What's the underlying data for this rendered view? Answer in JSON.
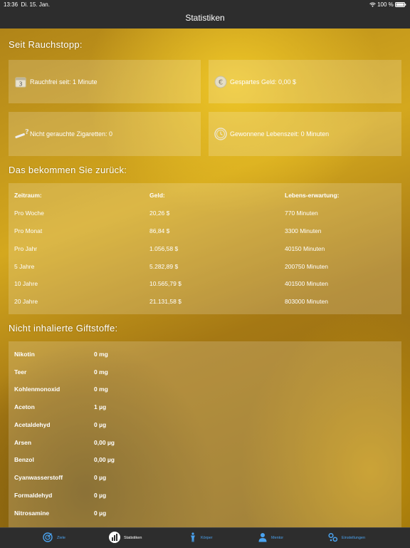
{
  "status_bar": {
    "time": "13:36",
    "date": "Di. 15. Jan.",
    "battery": "100 %"
  },
  "nav": {
    "title": "Statistiken"
  },
  "since_quit": {
    "title": "Seit Rauchstopp:",
    "cards": [
      {
        "icon": "calendar-icon",
        "label": "Rauchfrei seit: 1 Minute"
      },
      {
        "icon": "euro-coin-icon",
        "label": "Gespartes Geld: 0,00 $"
      },
      {
        "icon": "cigarette-question-icon",
        "label": "Nicht gerauchte Zigaretten: 0"
      },
      {
        "icon": "clock-icon",
        "label": "Gewonnene Lebenszeit: 0 Minuten"
      }
    ]
  },
  "returns": {
    "title": "Das bekommen Sie zurück:",
    "headers": [
      "Zeitraum:",
      "Geld:",
      "Lebens-erwartung:"
    ],
    "rows": [
      [
        "Pro Woche",
        "20,26 $",
        "770 Minuten"
      ],
      [
        "Pro Monat",
        "86,84 $",
        "3300 Minuten"
      ],
      [
        "Pro Jahr",
        "1.056,58 $",
        "40150 Minuten"
      ],
      [
        "5 Jahre",
        "5.282,89 $",
        "200750 Minuten"
      ],
      [
        "10 Jahre",
        "10.565,79 $",
        "401500 Minuten"
      ],
      [
        "20 Jahre",
        "21.131,58 $",
        "803000 Minuten"
      ]
    ]
  },
  "toxins": {
    "title": "Nicht inhalierte Giftstoffe:",
    "rows": [
      [
        "Nikotin",
        "0 mg"
      ],
      [
        "Teer",
        "0 mg"
      ],
      [
        "Kohlenmonoxid",
        "0 mg"
      ],
      [
        "Aceton",
        "1 µg"
      ],
      [
        "Acetaldehyd",
        "0 µg"
      ],
      [
        "Arsen",
        "0,00 µg"
      ],
      [
        "Benzol",
        "0,00 µg"
      ],
      [
        "Cyanwasserstoff",
        "0 µg"
      ],
      [
        "Formaldehyd",
        "0 µg"
      ],
      [
        "Nitrosamine",
        "0 µg"
      ]
    ]
  },
  "tabs": [
    {
      "label": "Ziele",
      "icon": "target-icon",
      "active": false
    },
    {
      "label": "Statistiken",
      "icon": "bar-chart-icon",
      "active": true
    },
    {
      "label": "Körper",
      "icon": "body-icon",
      "active": false
    },
    {
      "label": "Mentor",
      "icon": "person-icon",
      "active": false
    },
    {
      "label": "Einstellungen",
      "icon": "settings-icon",
      "active": false
    }
  ],
  "colors": {
    "bar": "#2d2d2d",
    "tab_accent": "#4aa3f0",
    "gold": "#d4a81e"
  }
}
